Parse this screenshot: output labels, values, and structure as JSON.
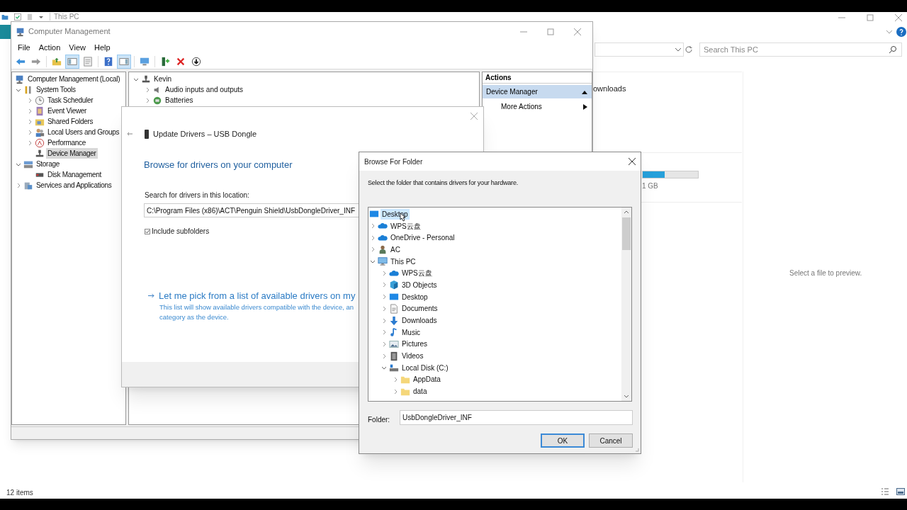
{
  "explorer": {
    "title": "This PC",
    "search": {
      "placeholder": "Search This PC"
    },
    "partial_item": "ownloads",
    "drive": {
      "level": 0.4,
      "reading": "1 GB"
    },
    "preview_text": "Select a file to preview.",
    "status": "12 items"
  },
  "computer_management": {
    "title": "Computer Management",
    "menu": [
      "File",
      "Action",
      "View",
      "Help"
    ],
    "toolbar": [
      {
        "kind": "back",
        "pressed": false
      },
      {
        "kind": "forward",
        "pressed": false
      },
      {
        "kind": "up",
        "pressed": false
      },
      {
        "kind": "tree",
        "pressed": true
      },
      {
        "kind": "properties",
        "pressed": false
      },
      {
        "kind": "help",
        "pressed": false
      },
      {
        "kind": "pane",
        "pressed": true
      },
      {
        "kind": "monitor",
        "pressed": false
      },
      {
        "kind": "update",
        "pressed": false
      },
      {
        "kind": "uninstall",
        "pressed": false
      },
      {
        "kind": "download",
        "pressed": false
      }
    ],
    "tree": [
      {
        "label": "Computer Management (Local)",
        "kind": "computer-mgmt",
        "selected": false,
        "children": [
          {
            "label": "System Tools",
            "kind": "tools",
            "expanded": true,
            "selected": false,
            "children": [
              {
                "label": "Task Scheduler",
                "kind": "clock",
                "expanded": false,
                "selected": false
              },
              {
                "label": "Event Viewer",
                "kind": "event",
                "expanded": false,
                "selected": false
              },
              {
                "label": "Shared Folders",
                "kind": "shared",
                "expanded": false,
                "selected": false
              },
              {
                "label": "Local Users and Groups",
                "kind": "users",
                "expanded": false,
                "selected": false
              },
              {
                "label": "Performance",
                "kind": "performance",
                "expanded": false,
                "selected": false
              },
              {
                "label": "Device Manager",
                "kind": "device",
                "selected": true
              }
            ]
          },
          {
            "label": "Storage",
            "kind": "storage",
            "expanded": true,
            "selected": false,
            "children": [
              {
                "label": "Disk Management",
                "kind": "disk",
                "selected": false
              }
            ]
          },
          {
            "label": "Services and Applications",
            "kind": "services",
            "expanded": false,
            "selected": false
          }
        ]
      }
    ],
    "devices": [
      {
        "label": "Kevin",
        "kind": "device",
        "expanded": true,
        "children": [
          {
            "label": "Audio inputs and outputs",
            "kind": "audio",
            "expanded": false
          },
          {
            "label": "Batteries",
            "kind": "battery",
            "expanded": false
          }
        ]
      }
    ],
    "actions": {
      "header": "Actions",
      "items": [
        {
          "label": "Device Manager",
          "kind": "section",
          "selected": true
        },
        {
          "label": "More Actions",
          "kind": "submenu",
          "selected": false
        }
      ]
    }
  },
  "update_drivers": {
    "title": "Update Drivers – USB Dongle",
    "heading": "Browse for drivers on your computer",
    "location_label": "Search for drivers in this location:",
    "location_value": "C:\\Program Files (x86)\\ACT\\Penguin Shield\\UsbDongleDriver_INF",
    "include_subfolders": {
      "label": "Include subfolders",
      "checked": true
    },
    "pick_link": "Let me pick from a list of available drivers on my",
    "pick_description": [
      "This list will show available drivers compatible with the device, an",
      "category as the device."
    ]
  },
  "browse_folder": {
    "title": "Browse For Folder",
    "instruction": "Select the folder that contains drivers for your hardware.",
    "tree": [
      {
        "label": "Desktop",
        "kind": "desktop",
        "selected": true,
        "children": [
          {
            "label": "WPS云盘",
            "kind": "cloud",
            "expanded": false,
            "selected": false
          },
          {
            "label": "OneDrive - Personal",
            "kind": "cloud",
            "expanded": false,
            "selected": false
          },
          {
            "label": "AC",
            "kind": "user",
            "expanded": false,
            "selected": false
          },
          {
            "label": "This PC",
            "kind": "monitor",
            "expanded": true,
            "selected": false,
            "children": [
              {
                "label": "WPS云盘",
                "kind": "cloud",
                "expanded": false,
                "selected": false
              },
              {
                "label": "3D Objects",
                "kind": "cube",
                "expanded": false,
                "selected": false
              },
              {
                "label": "Desktop",
                "kind": "desktop",
                "expanded": false,
                "selected": false
              },
              {
                "label": "Documents",
                "kind": "document",
                "expanded": false,
                "selected": false
              },
              {
                "label": "Downloads",
                "kind": "download",
                "expanded": false,
                "selected": false
              },
              {
                "label": "Music",
                "kind": "music",
                "expanded": false,
                "selected": false
              },
              {
                "label": "Pictures",
                "kind": "pictures",
                "expanded": false,
                "selected": false
              },
              {
                "label": "Videos",
                "kind": "video",
                "expanded": false,
                "selected": false
              },
              {
                "label": "Local Disk (C:)",
                "kind": "drive",
                "expanded": true,
                "selected": false,
                "children": [
                  {
                    "label": "AppData",
                    "kind": "folder",
                    "expanded": false,
                    "selected": false
                  },
                  {
                    "label": "data",
                    "kind": "folder",
                    "expanded": false,
                    "selected": false
                  }
                ]
              }
            ]
          }
        ]
      }
    ],
    "folder_label": "Folder:",
    "folder_value": "UsbDongleDriver_INF",
    "buttons": [
      {
        "label": "OK",
        "kind": "default"
      },
      {
        "label": "Cancel",
        "kind": "normal"
      }
    ]
  }
}
